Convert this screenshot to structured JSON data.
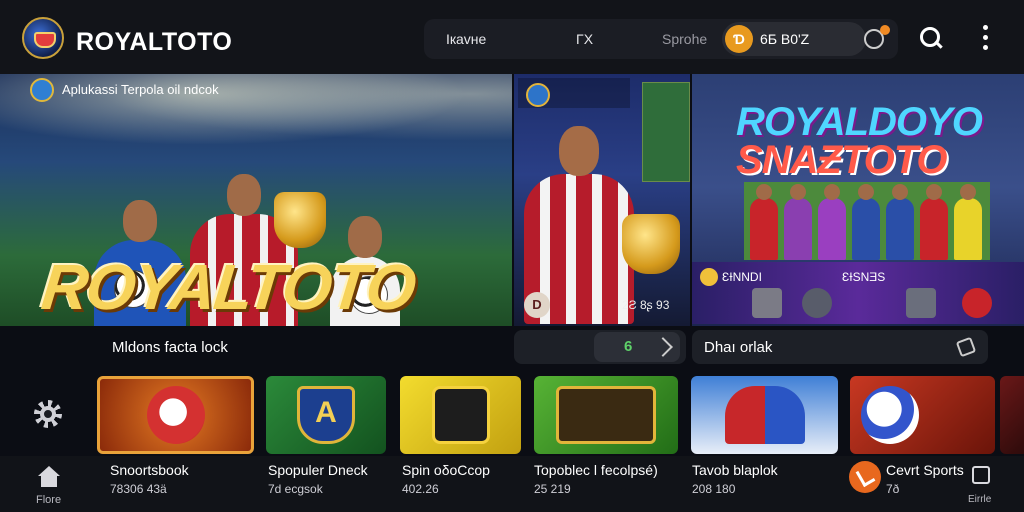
{
  "header": {
    "brand": "ROYALTOTO",
    "nav": [
      "Ікavнe",
      "ΓΧ",
      "Sprohe"
    ],
    "balance": "6Ƃ B0'Z",
    "coin_symbol": "Ɗ"
  },
  "hero": {
    "tag": "Aplukassi Terpola oil ndcok",
    "title": "ROYALTOTO"
  },
  "mid_banner": {
    "badge": "D",
    "number": "2Ƨ 8ʂ 93"
  },
  "right_banner": {
    "title_line1": "ROYALDOYO",
    "title_line2": "SNAƵTOTO",
    "strip_tag1": "ƐƗNNDI",
    "strip_tag2": "ƐƗSNƎS"
  },
  "section": {
    "title": "Mldons facta lock",
    "mid_value": "6",
    "right_label": "Dhaı orlak"
  },
  "cards": [
    {
      "name": "sportsbook"
    },
    {
      "name": "a-shield"
    },
    {
      "name": "sa"
    },
    {
      "name": "family"
    },
    {
      "name": "football"
    },
    {
      "name": "sports"
    },
    {
      "name": "extra"
    }
  ],
  "bottom_nav": {
    "home_label": "Flore",
    "items": [
      {
        "title": "Snoortsbook",
        "sub": "78306 43ä"
      },
      {
        "title": "Spopuler Dneck",
        "sub": "7d ecgsok"
      },
      {
        "title": "Spin oδoCcop",
        "sub": "402.26"
      },
      {
        "title": "Topoblec l fecolpsé)",
        "sub": "25 219"
      },
      {
        "title": "Tavob blaplok",
        "sub": "208 180"
      },
      {
        "title": "Cevrt Sports",
        "sub": "7ð"
      }
    ],
    "last_label": "Eirrle"
  },
  "colors": {
    "accent_orange": "#e8681e",
    "brand_gold": "#f7d35a",
    "balance_green": "#5ed169",
    "background": "#0b0d14"
  }
}
